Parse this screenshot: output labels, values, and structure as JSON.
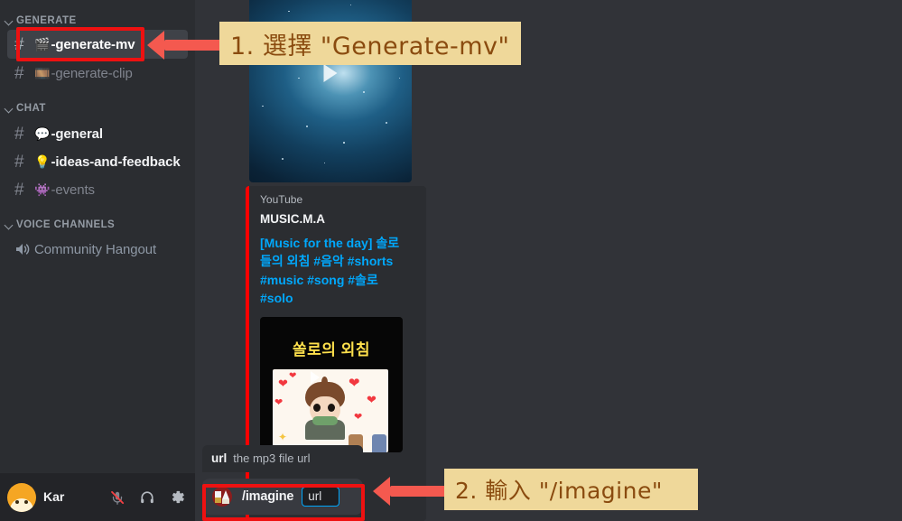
{
  "sidebar": {
    "categories": [
      {
        "label": "GENERATE"
      },
      {
        "label": "CHAT"
      },
      {
        "label": "VOICE CHANNELS"
      }
    ],
    "channels_generate": [
      {
        "emoji": "🎬",
        "name": "-generate-mv",
        "state": "active",
        "icon": "hash-icon"
      },
      {
        "emoji": "🎞️",
        "name": "-generate-clip",
        "state": "muted",
        "icon": "hash-icon"
      }
    ],
    "channels_chat": [
      {
        "emoji": "💬",
        "name": "-general",
        "state": "unread",
        "icon": "hash-icon"
      },
      {
        "emoji": "💡",
        "name": "-ideas-and-feedback",
        "state": "unread",
        "icon": "hash-icon"
      },
      {
        "emoji": "👾",
        "name": "-events",
        "state": "muted",
        "icon": "hash-icon"
      }
    ],
    "voice_channels": [
      {
        "name": "Community Hangout",
        "icon": "speaker-icon"
      }
    ],
    "add_channel_glyph": "+",
    "user": {
      "name": "Kar",
      "tag": "",
      "mic_icon": "microphone-muted-icon",
      "headset_icon": "headphones-icon",
      "settings_icon": "gear-icon"
    }
  },
  "message": {
    "video_preview_alt": "galaxy-nebula-video",
    "embed": {
      "provider": "YouTube",
      "author": "MUSIC.M.A",
      "title": "[Music for the day] 솔로들의 외침 #음악 #shorts #music #song #솔로 #solo",
      "thumbnail_title": "쏠로의 외침"
    }
  },
  "composer": {
    "autocomplete": {
      "param_key": "url",
      "param_desc": "the mp3 file url"
    },
    "app_icon": "midjourney-icon",
    "command": "/imagine",
    "param_chip": "url"
  },
  "annotations": [
    {
      "id": "step-1",
      "text": "1. 選擇 \"Generate-mv\""
    },
    {
      "id": "step-2",
      "text": "2. 輸入 \"/imagine\""
    }
  ],
  "colors": {
    "sidebar_bg": "#2b2d31",
    "main_bg": "#313338",
    "userbar_bg": "#232428",
    "accent_link": "#00a8fc",
    "annotation_bg": "#efd89a",
    "annotation_text": "#8a4b0f",
    "highlight_red": "#ee1111",
    "arrow_red": "#f4594f",
    "youtube_red": "#ff0000"
  }
}
